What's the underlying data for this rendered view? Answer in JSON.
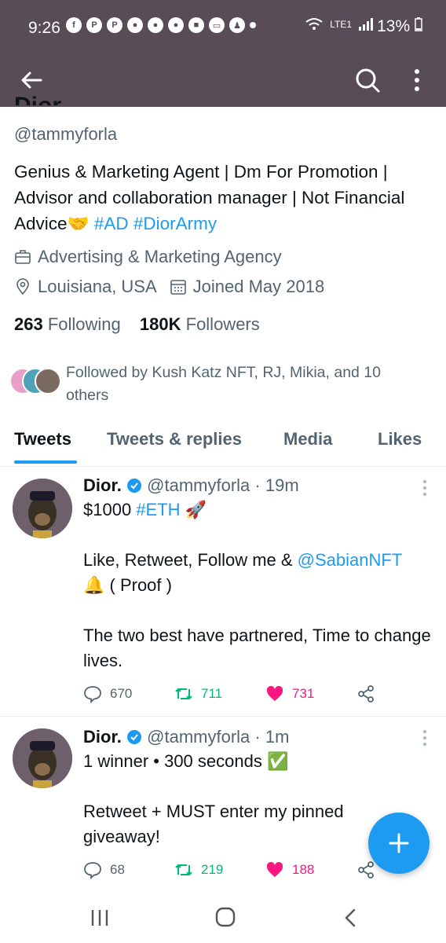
{
  "status_bar": {
    "time": "9:26",
    "battery": "13%",
    "network": "LTE1"
  },
  "profile": {
    "name": "Dior.",
    "handle": "@tammyforla",
    "bio_text_1": "Genius & Marketing Agent | Dm For Promotion | Advisor and collaboration manager | Not Financial Advice",
    "bio_emoji": "🤝",
    "bio_tag_1": "#AD",
    "bio_tag_2": "#DiorArmy",
    "category": "Advertising & Marketing Agency",
    "location": "Louisiana, USA",
    "joined": "Joined May 2018",
    "following_count": "263",
    "following_label": "Following",
    "followers_count": "180K",
    "followers_label": "Followers",
    "followed_by": "Followed by Kush Katz NFT, RJ, Mikia, and 10 others"
  },
  "tabs": [
    {
      "label": "Tweets"
    },
    {
      "label": "Tweets & replies"
    },
    {
      "label": "Media"
    },
    {
      "label": "Likes"
    }
  ],
  "tweets": [
    {
      "name": "Dior.",
      "handle": "@tammyforla",
      "time": "· 19m",
      "line1_text": "$1000",
      "line1_tag": "#ETH",
      "line1_emoji": "🚀",
      "line2_text": "Like, Retweet, Follow me &",
      "line2_mention": "@SabianNFT",
      "line3_text": "🔔 ( Proof )",
      "line4_text": "The two best have partnered, Time to change lives.",
      "replies": "670",
      "retweets": "711",
      "likes": "731"
    },
    {
      "name": "Dior.",
      "handle": "@tammyforla",
      "time": "· 1m",
      "line1_text": "1 winner • 300 seconds ✅",
      "line2_text": "Retweet + MUST enter my pinned giveaway!",
      "replies": "68",
      "retweets": "219",
      "likes": "188"
    }
  ],
  "colors": {
    "accent": "#1d9bf0",
    "header_bg": "#584c57",
    "retweet": "#00ba7c",
    "like": "#f91880",
    "muted_text": "#536471"
  }
}
